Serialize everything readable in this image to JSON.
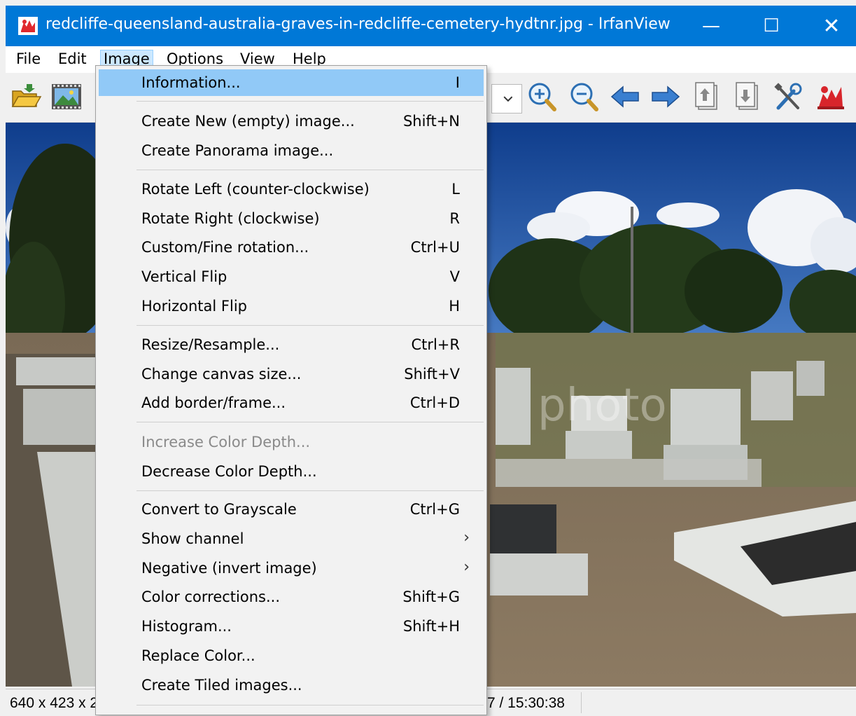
{
  "window": {
    "title": "redcliffe-queensland-australia-graves-in-redcliffe-cemetery-hydtnr.jpg - IrfanView",
    "minimize": "—",
    "maximize": "☐",
    "close": "✕"
  },
  "menubar": {
    "items": [
      "File",
      "Edit",
      "Image",
      "Options",
      "View",
      "Help"
    ]
  },
  "image_menu": {
    "items": [
      {
        "label": "Information...",
        "shortcut": "I"
      },
      {
        "label": "Create New (empty) image...",
        "shortcut": "Shift+N"
      },
      {
        "label": "Create Panorama image...",
        "shortcut": ""
      },
      {
        "label": "Rotate Left (counter-clockwise)",
        "shortcut": "L"
      },
      {
        "label": "Rotate Right (clockwise)",
        "shortcut": "R"
      },
      {
        "label": "Custom/Fine rotation...",
        "shortcut": "Ctrl+U"
      },
      {
        "label": "Vertical Flip",
        "shortcut": "V"
      },
      {
        "label": "Horizontal Flip",
        "shortcut": "H"
      },
      {
        "label": "Resize/Resample...",
        "shortcut": "Ctrl+R"
      },
      {
        "label": "Change canvas size...",
        "shortcut": "Shift+V"
      },
      {
        "label": "Add border/frame...",
        "shortcut": "Ctrl+D"
      },
      {
        "label": "Increase Color Depth...",
        "shortcut": "",
        "disabled": true
      },
      {
        "label": "Decrease Color Depth...",
        "shortcut": ""
      },
      {
        "label": "Convert to Grayscale",
        "shortcut": "Ctrl+G"
      },
      {
        "label": "Show channel",
        "shortcut": "",
        "submenu": "›"
      },
      {
        "label": "Negative (invert image)",
        "shortcut": "",
        "submenu": "›"
      },
      {
        "label": "Color corrections...",
        "shortcut": "Shift+G"
      },
      {
        "label": "Histogram...",
        "shortcut": "Shift+H"
      },
      {
        "label": "Replace Color...",
        "shortcut": ""
      },
      {
        "label": "Create Tiled images...",
        "shortcut": ""
      }
    ]
  },
  "statusbar": {
    "dimensions": "640 x 423 x 2",
    "datetime": "7 / 15:30:38"
  },
  "image": {
    "watermark": "photo"
  },
  "colors": {
    "titlebar": "#0078d7",
    "menu_highlight": "#91c9f7",
    "disabled_text": "#8a8a8a"
  },
  "icons": [
    "open-folder-icon",
    "slideshow-icon",
    "zoom-in-icon",
    "zoom-out-icon",
    "previous-icon",
    "next-icon",
    "page-up-icon",
    "page-down-icon",
    "settings-tools-icon",
    "irfanview-logo-icon"
  ]
}
